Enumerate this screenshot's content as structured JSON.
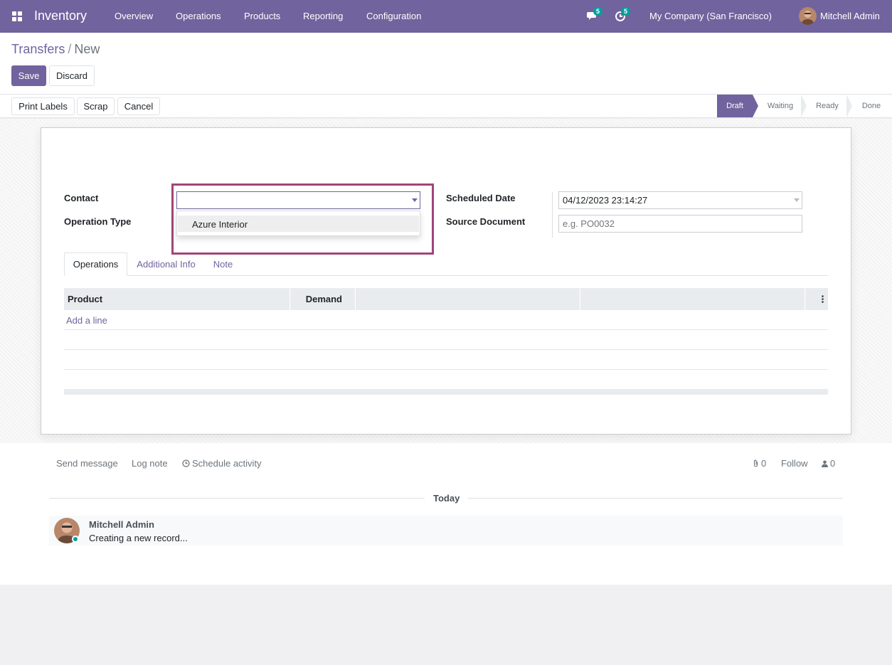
{
  "navbar": {
    "app_name": "Inventory",
    "menu": [
      "Overview",
      "Operations",
      "Products",
      "Reporting",
      "Configuration"
    ],
    "messages_count": "5",
    "activities_count": "5",
    "company": "My Company (San Francisco)",
    "user": "Mitchell Admin",
    "accent_color": "#71639e"
  },
  "breadcrumb": {
    "parent": "Transfers",
    "separator": "/",
    "current": "New"
  },
  "control": {
    "save_label": "Save",
    "discard_label": "Discard"
  },
  "statusbar": {
    "buttons": [
      "Print Labels",
      "Scrap",
      "Cancel"
    ],
    "stages": [
      "Draft",
      "Waiting",
      "Ready",
      "Done"
    ],
    "active_stage": "Draft"
  },
  "form": {
    "contact_label": "Contact",
    "contact_value": "",
    "operation_type_label": "Operation Type",
    "scheduled_date_label": "Scheduled Date",
    "scheduled_date_value": "04/12/2023 23:14:27",
    "source_document_label": "Source Document",
    "source_document_placeholder": "e.g. PO0032",
    "contact_dropdown_options": [
      "Azure Interior"
    ]
  },
  "tabs": [
    "Operations",
    "Additional Info",
    "Note"
  ],
  "active_tab": "Operations",
  "operations_table": {
    "columns": [
      "Product",
      "Demand",
      "",
      ""
    ],
    "add_line_label": "Add a line",
    "rows": []
  },
  "chatter": {
    "send_message_label": "Send message",
    "log_note_label": "Log note",
    "schedule_activity_label": "Schedule activity",
    "attachments_count": "0",
    "follow_label": "Follow",
    "followers_count": "0",
    "date_separator": "Today",
    "messages": [
      {
        "author": "Mitchell Admin",
        "body": "Creating a new record..."
      }
    ]
  }
}
